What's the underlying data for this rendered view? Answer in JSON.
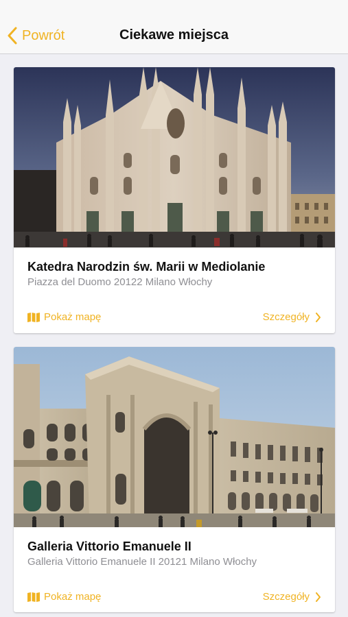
{
  "navbar": {
    "back_label": "Powrót",
    "title": "Ciekawe miejsca"
  },
  "places": [
    {
      "title": "Katedra Narodzin św. Marii w Mediolanie",
      "address": "Piazza del Duomo 20122 Milano Włochy",
      "map_label": "Pokaż mapę",
      "details_label": "Szczegóły"
    },
    {
      "title": "Galleria Vittorio Emanuele II",
      "address": "Galleria Vittorio Emanuele II 20121 Milano Włochy",
      "map_label": "Pokaż mapę",
      "details_label": "Szczegóły"
    }
  ],
  "colors": {
    "accent": "#f0b323",
    "background": "#efeff4",
    "secondary_text": "#8e8e93"
  },
  "icons": {
    "back": "chevron-left-icon",
    "map": "map-icon",
    "details": "chevron-right-icon"
  }
}
